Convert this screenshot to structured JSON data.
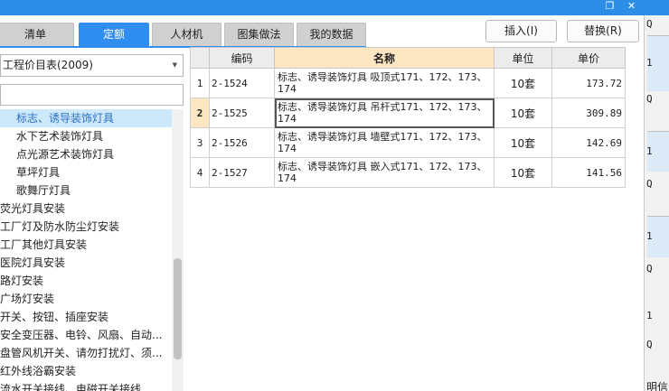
{
  "titlebar": {
    "icons": [
      "restore-icon",
      "close-icon"
    ],
    "glyphs": [
      "❐",
      "✕"
    ]
  },
  "tabs": [
    {
      "label": "清单",
      "active": false
    },
    {
      "label": "定额",
      "active": true
    },
    {
      "label": "人材机",
      "active": false
    },
    {
      "label": "图集做法",
      "active": false
    },
    {
      "label": "我的数据",
      "active": false
    }
  ],
  "buttons": {
    "insert": "插入(I)",
    "replace": "替换(R)"
  },
  "left_panel": {
    "select_value": "工程价目表(2009)",
    "search_value": "",
    "tree": [
      {
        "label": "标志、诱导装饰灯具",
        "indent": true,
        "selected": true
      },
      {
        "label": "水下艺术装饰灯具",
        "indent": true,
        "selected": false
      },
      {
        "label": "点光源艺术装饰灯具",
        "indent": true,
        "selected": false
      },
      {
        "label": "草坪灯具",
        "indent": true,
        "selected": false
      },
      {
        "label": "歌舞厅灯具",
        "indent": true,
        "selected": false
      },
      {
        "label": "荧光灯具安装",
        "indent": false,
        "selected": false
      },
      {
        "label": "工厂灯及防水防尘灯安装",
        "indent": false,
        "selected": false
      },
      {
        "label": "工厂其他灯具安装",
        "indent": false,
        "selected": false
      },
      {
        "label": "医院灯具安装",
        "indent": false,
        "selected": false
      },
      {
        "label": "路灯安装",
        "indent": false,
        "selected": false
      },
      {
        "label": "广场灯安装",
        "indent": false,
        "selected": false
      },
      {
        "label": "开关、按钮、插座安装",
        "indent": false,
        "selected": false
      },
      {
        "label": "安全变压器、电铃、风扇、自动...",
        "indent": false,
        "selected": false
      },
      {
        "label": "盘管风机开关、请勿打扰灯、须...",
        "indent": false,
        "selected": false
      },
      {
        "label": "红外线浴霸安装",
        "indent": false,
        "selected": false
      },
      {
        "label": "流水开关接线、电磁开关接线",
        "indent": false,
        "selected": false
      }
    ]
  },
  "table": {
    "headers": {
      "code": "编码",
      "name": "名称",
      "unit": "单位",
      "price": "单价"
    },
    "rows": [
      {
        "idx": "1",
        "code": "2-1524",
        "name": "标志、诱导装饰灯具 吸顶式171、172、173、174",
        "unit": "10套",
        "price": "173.72"
      },
      {
        "idx": "2",
        "code": "2-1525",
        "name": "标志、诱导装饰灯具 吊杆式171、172、173、174",
        "unit": "10套",
        "price": "309.89"
      },
      {
        "idx": "3",
        "code": "2-1526",
        "name": "标志、诱导装饰灯具 墙壁式171、172、173、174",
        "unit": "10套",
        "price": "142.69"
      },
      {
        "idx": "4",
        "code": "2-1527",
        "name": "标志、诱导装饰灯具 嵌入式171、172、173、174",
        "unit": "10套",
        "price": "141.56"
      }
    ]
  },
  "background_window": {
    "cells": [
      "Q",
      "1",
      "Q",
      "1",
      "Q",
      "1",
      "Q",
      "1",
      "Q"
    ],
    "footer_text": "明信息"
  }
}
